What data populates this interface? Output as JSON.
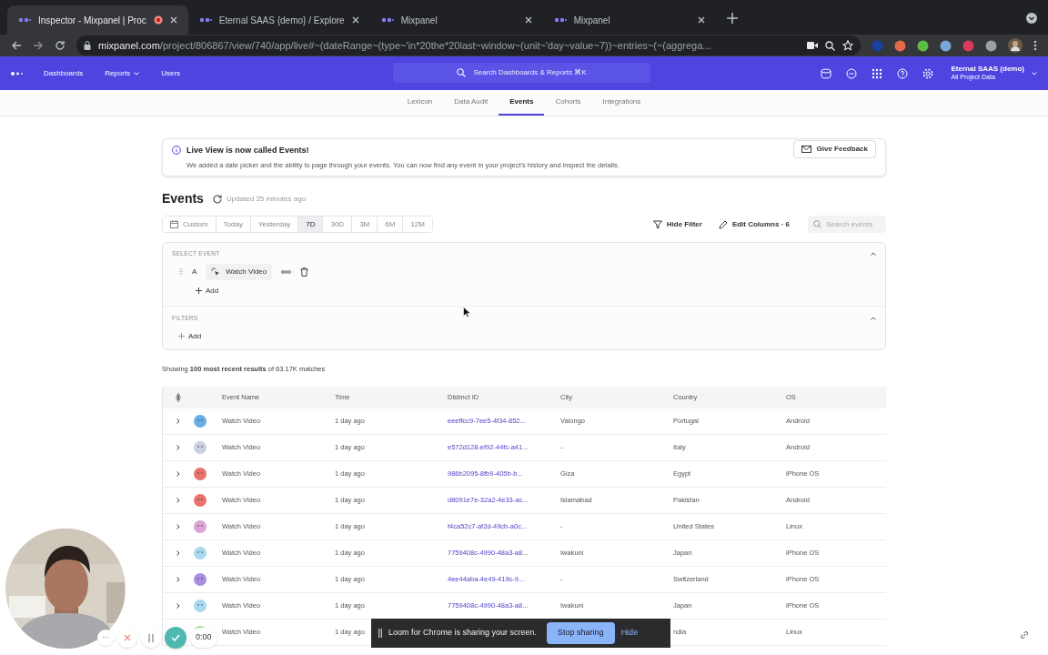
{
  "browser": {
    "tabs": [
      {
        "title": "Inspector - Mixpanel | Proc",
        "selected": true,
        "recording": true
      },
      {
        "title": "Eternal SAAS {demo} / Explore",
        "selected": false,
        "recording": false
      },
      {
        "title": "Mixpanel",
        "selected": false,
        "recording": false
      },
      {
        "title": "Mixpanel",
        "selected": false,
        "recording": false
      }
    ],
    "url": {
      "domain": "mixpanel.com",
      "path": "/project/806867/view/740/app/live#~(dateRange~(type~'in*20the*20last~window~(unit~'day~value~7))~entries~(~(aggrega..."
    }
  },
  "nav": {
    "items": [
      {
        "label": "Dashboards",
        "dropdown": false
      },
      {
        "label": "Reports",
        "dropdown": true
      },
      {
        "label": "Users",
        "dropdown": false
      }
    ],
    "search": {
      "placeholder": "Search Dashboards & Reports ⌘K"
    },
    "account": {
      "name": "Eternal SAAS (demo)",
      "subtitle": "All Project Data"
    }
  },
  "subnav": [
    {
      "label": "Lexicon",
      "selected": false
    },
    {
      "label": "Data Audit",
      "selected": false
    },
    {
      "label": "Events",
      "selected": true
    },
    {
      "label": "Cohorts",
      "selected": false
    },
    {
      "label": "Integrations",
      "selected": false
    }
  ],
  "banner": {
    "title": "Live View is now called Events!",
    "text": "We added a date picker and the ability to page through your events. You can now find any event in your project's history and inspect the details.",
    "button": "Give Feedback"
  },
  "header": {
    "title": "Events",
    "updated": "Updated 25 minutes ago"
  },
  "date_ranges": [
    {
      "label": "Custom",
      "selected": false
    },
    {
      "label": "Today",
      "selected": false
    },
    {
      "label": "Yesterday",
      "selected": false
    },
    {
      "label": "7D",
      "selected": true
    },
    {
      "label": "30D",
      "selected": false
    },
    {
      "label": "3M",
      "selected": false
    },
    {
      "label": "6M",
      "selected": false
    },
    {
      "label": "12M",
      "selected": false
    }
  ],
  "actions": {
    "hide_filter": "Hide Filter",
    "edit_columns": "Edit Columns · 6",
    "search": {
      "placeholder": "Search events"
    }
  },
  "select_event": {
    "heading": "SELECT EVENT",
    "letter": "A",
    "event": "Watch Video",
    "add": "Add"
  },
  "filters": {
    "heading": "FILTERS",
    "add": "Add"
  },
  "summary": "Showing **100 most recent results** of 63.17K matches",
  "table": {
    "columns": [
      "Event Name",
      "Time",
      "Distinct ID",
      "City",
      "Country",
      "OS"
    ],
    "rows": [
      {
        "color": "#6aaee8",
        "cells": [
          "Watch Video",
          "1 day ago",
          "eeeffcc9-7ee5-4f34-852...",
          "Valongo",
          "Portugal",
          "Android"
        ]
      },
      {
        "color": "#c9d0e2",
        "cells": [
          "Watch Video",
          "1 day ago",
          "e572d128-ef92-44fc-a41...",
          "-",
          "Italy",
          "Android"
        ]
      },
      {
        "color": "#e8736c",
        "cells": [
          "Watch Video",
          "1 day ago",
          "986b2095-8fb9-405b-b...",
          "Giza",
          "Egypt",
          "iPhone OS"
        ]
      },
      {
        "color": "#e8736c",
        "cells": [
          "Watch Video",
          "1 day ago",
          "d8091e7e-32a2-4e33-ac...",
          "Islamabad",
          "Pakistan",
          "Android"
        ]
      },
      {
        "color": "#dba3d6",
        "cells": [
          "Watch Video",
          "1 day ago",
          "f4ca52c7-af2d-49cb-a0c...",
          "-",
          "United States",
          "Linux"
        ]
      },
      {
        "color": "#a9d9ef",
        "cells": [
          "Watch Video",
          "1 day ago",
          "7759408c-4990-48a3-a8...",
          "Iwakuni",
          "Japan",
          "iPhone OS"
        ]
      },
      {
        "color": "#a98fe2",
        "cells": [
          "Watch Video",
          "1 day ago",
          "4ee44aba-4e49-419c-9...",
          "-",
          "Switzerland",
          "iPhone OS"
        ]
      },
      {
        "color": "#a9d9ef",
        "cells": [
          "Watch Video",
          "1 day ago",
          "7759408c-4990-48a3-a8...",
          "Iwakuni",
          "Japan",
          "iPhone OS"
        ]
      },
      {
        "color": "#a6e08c",
        "cells": [
          "Watch Video",
          "1 day ago",
          null,
          null,
          "ndia",
          "Linux"
        ]
      }
    ]
  },
  "loom": {
    "message": "Loom for Chrome is sharing your screen.",
    "stop": "Stop sharing",
    "hide": "Hide",
    "timer": "0:00",
    "more": "···"
  }
}
